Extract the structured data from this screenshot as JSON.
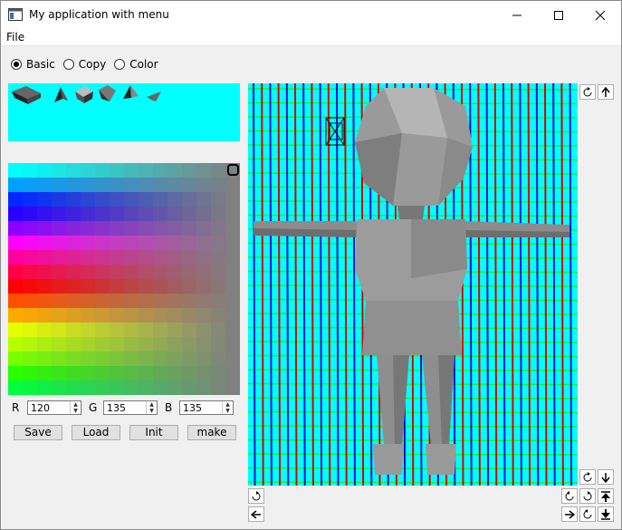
{
  "window": {
    "title": "My application with menu"
  },
  "menu": {
    "file": "File"
  },
  "modes": [
    {
      "label": "Basic",
      "selected": true
    },
    {
      "label": "Copy",
      "selected": false
    },
    {
      "label": "Color",
      "selected": false
    }
  ],
  "rgb": {
    "r_label": "R",
    "r_value": "120",
    "g_label": "G",
    "g_value": "135",
    "b_label": "B",
    "b_value": "135"
  },
  "buttons": {
    "save": "Save",
    "load": "Load",
    "init": "Init",
    "make": "make"
  },
  "colors": {
    "viewport_bg": "#00ffff",
    "shapes_bg": "#00ffff",
    "model": "#8c8c8c"
  }
}
